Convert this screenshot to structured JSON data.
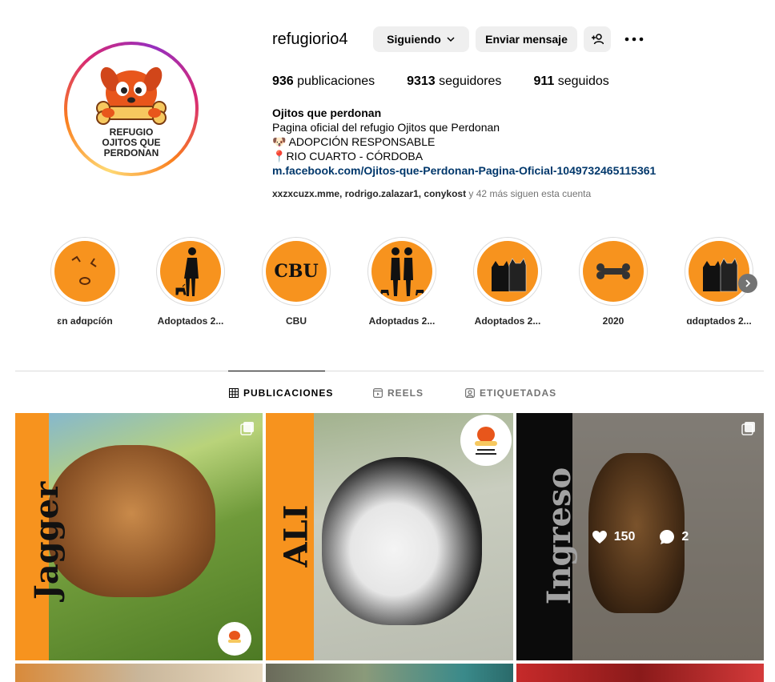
{
  "profile": {
    "username": "refugiorio4",
    "follow_label": "Siguiendo",
    "message_label": "Enviar mensaje",
    "logo_text_1": "REFUGIO",
    "logo_text_2": "OJITOS QUE",
    "logo_text_3": "PERDONAN"
  },
  "stats": {
    "posts_count": "936",
    "posts_label": "publicaciones",
    "followers_count": "9313",
    "followers_label": "seguidores",
    "following_count": "911",
    "following_label": "seguidos"
  },
  "bio": {
    "name": "Ojitos que perdonan",
    "line1": "Pagina oficial del refugio Ojitos que Perdonan",
    "line2": "ADOPCIÓN RESPONSABLE",
    "line3": "RIO CUARTO - CÓRDOBA",
    "link": "m.facebook.com/Ojitos-que-Perdonan-Pagina-Oficial-1049732465115361"
  },
  "followed_by": {
    "users": "xxzxcuzx.mme, rodrigo.zalazar1, conykost",
    "suffix": " y 42 más siguen esta cuenta"
  },
  "highlights": [
    {
      "label": "ɛn aძɑpcíón",
      "icon": "paw-icon"
    },
    {
      "label": "Adoptados 2...",
      "icon": "person-dog-icon"
    },
    {
      "label": "CBU",
      "icon": "cbu-text"
    },
    {
      "label": "Adoptadɑs 2...",
      "icon": "couple-dog-icon"
    },
    {
      "label": "Adoptados 2...",
      "icon": "cats-icon"
    },
    {
      "label": "2020",
      "icon": "bone-icon"
    },
    {
      "label": "ɑdɑptados 2...",
      "icon": "cats-icon"
    }
  ],
  "tabs": [
    {
      "label": "PUBLICACIONES",
      "icon": "grid-icon",
      "active": true
    },
    {
      "label": "REELS",
      "icon": "reels-icon",
      "active": false
    },
    {
      "label": "ETIQUETADAS",
      "icon": "tagged-icon",
      "active": false
    }
  ],
  "posts": [
    {
      "name": "Jagger",
      "strip_color": "#f7931e",
      "text_color": "#000000"
    },
    {
      "name": "ALI",
      "strip_color": "#f7931e",
      "text_color": "#000000"
    },
    {
      "name": "Ingreso",
      "strip_color": "#111111",
      "text_color": "#e8e8e8",
      "likes": "150",
      "comments": "2"
    }
  ]
}
